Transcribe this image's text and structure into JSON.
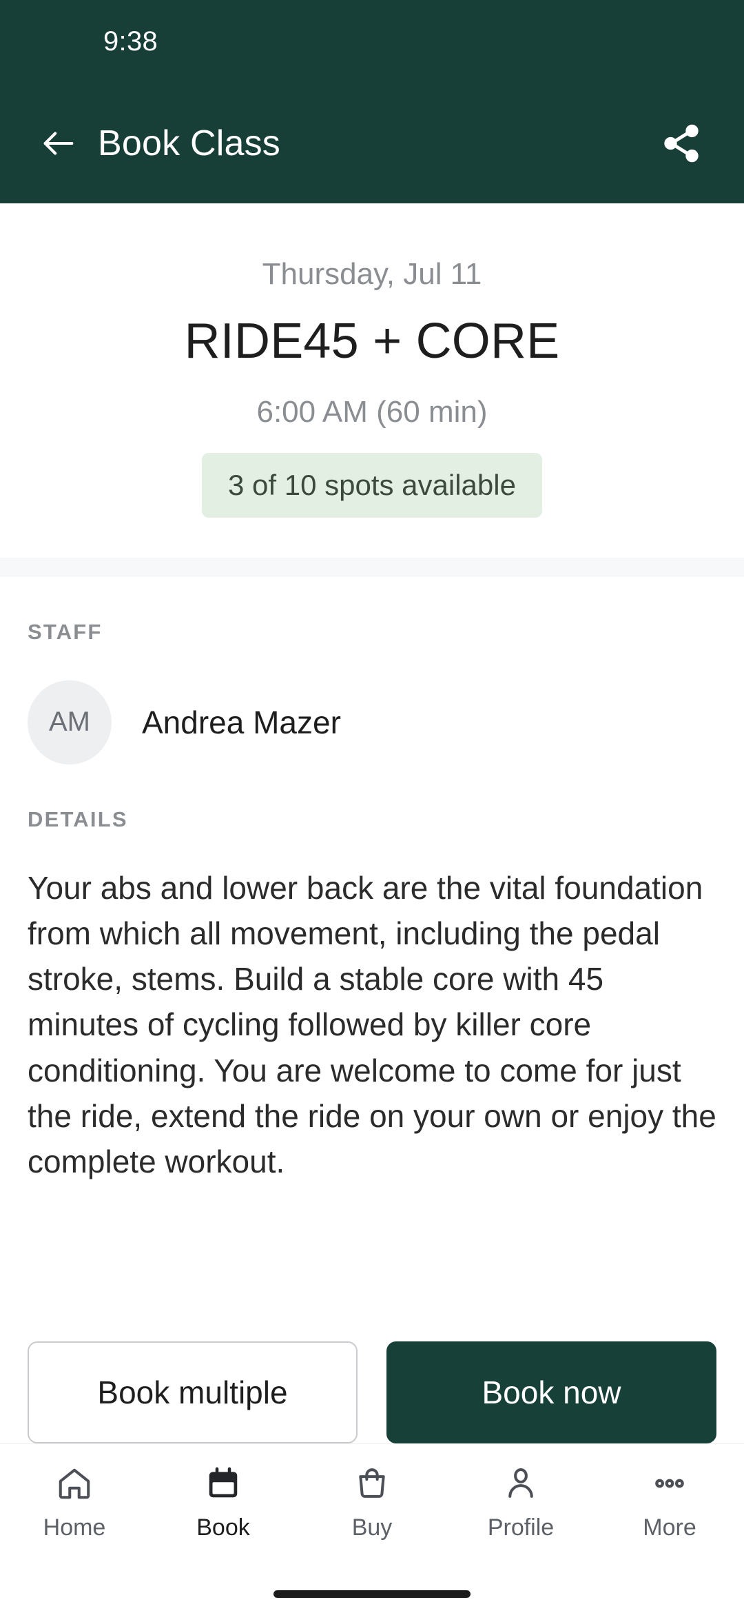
{
  "status_bar": {
    "time": "9:38"
  },
  "app_bar": {
    "title": "Book Class",
    "back_icon": "arrow-left-icon",
    "share_icon": "share-icon"
  },
  "hero": {
    "date": "Thursday, Jul 11",
    "title": "RIDE45 + CORE",
    "time": "6:00 AM (60 min)",
    "spots_badge": "3 of 10 spots available"
  },
  "staff_section": {
    "label": "STAFF",
    "avatar_initials": "AM",
    "name": "Andrea Mazer"
  },
  "details_section": {
    "label": "DETAILS",
    "body": "Your abs and lower back are the vital foundation from which all movement, including the pedal stroke, stems. Build a stable core with 45 minutes of cycling followed by killer core conditioning. You are welcome to come for just the ride, extend the ride on your own or enjoy the complete workout."
  },
  "actions": {
    "secondary_label": "Book multiple",
    "primary_label": "Book now"
  },
  "bottom_nav": {
    "items": [
      {
        "label": "Home",
        "icon": "home-icon",
        "active": false
      },
      {
        "label": "Book",
        "icon": "calendar-icon",
        "active": true
      },
      {
        "label": "Buy",
        "icon": "bag-icon",
        "active": false
      },
      {
        "label": "Profile",
        "icon": "person-icon",
        "active": false
      },
      {
        "label": "More",
        "icon": "more-dots-icon",
        "active": false
      }
    ]
  },
  "colors": {
    "brand_dark_green": "#173F37",
    "badge_background": "#E4EFE3",
    "badge_text": "#3B4A3D",
    "primary_button": "#174038",
    "muted_text": "#8A8D91",
    "avatar_background": "#EEEFF1"
  }
}
